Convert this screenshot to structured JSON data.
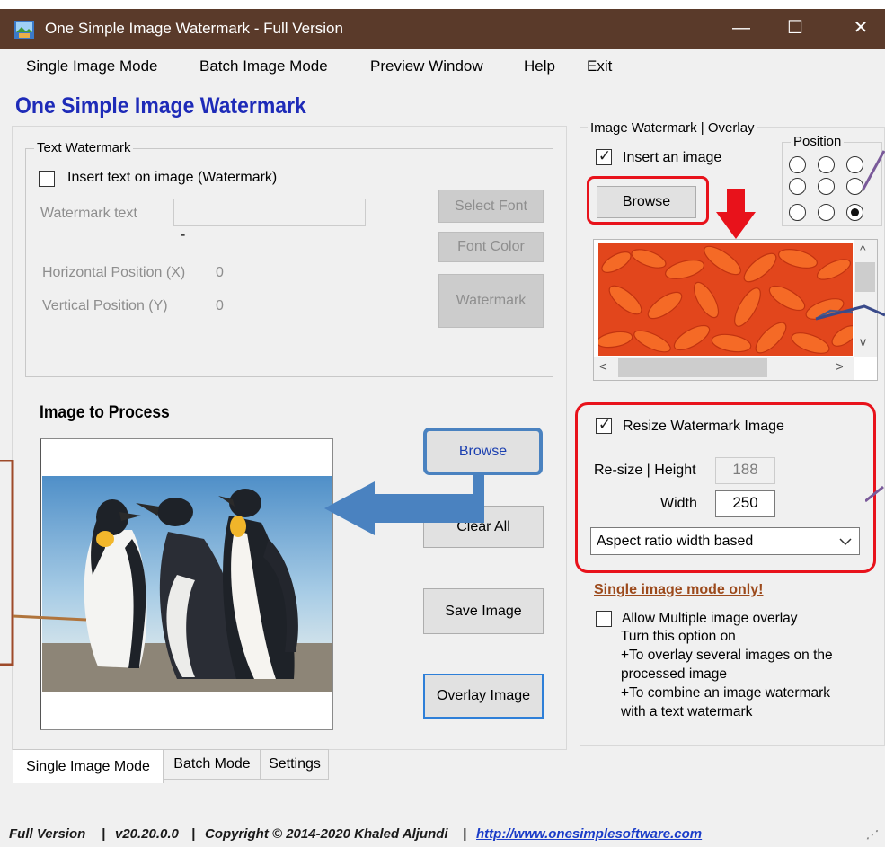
{
  "window": {
    "title": "One Simple Image Watermark - Full Version",
    "min_glyph": "—",
    "max_glyph": "☐",
    "close_glyph": "✕"
  },
  "menu": [
    "Single Image Mode",
    "Batch Image Mode",
    "Preview Window",
    "Help",
    "Exit"
  ],
  "heading": "One Simple Image Watermark",
  "text_watermark": {
    "legend": "Text Watermark",
    "insert_label": "Insert text on image (Watermark)",
    "insert_checked": false,
    "watermark_text_label": "Watermark text",
    "watermark_text_value": "",
    "dash": "-",
    "select_font_label": "Select Font",
    "font_color_label": "Font Color",
    "watermark_button_label": "Watermark",
    "hpos_label": "Horizontal Position (X)",
    "hpos_value": "0",
    "vpos_label": "Vertical Position (Y)",
    "vpos_value": "0"
  },
  "image_to_process": {
    "heading": "Image to Process",
    "browse_label": "Browse",
    "clear_all_label": "Clear All",
    "save_image_label": "Save Image",
    "overlay_image_label": "Overlay Image"
  },
  "image_overlay": {
    "legend": "Image Watermark | Overlay",
    "insert_label": "Insert an image",
    "insert_checked": true,
    "browse_label": "Browse",
    "position_legend": "Position",
    "position_selected": 8,
    "scroll_up": "^",
    "scroll_down": "v",
    "scroll_left": "<",
    "scroll_right": ">"
  },
  "resize": {
    "checkbox_label": "Resize Watermark Image",
    "checked": true,
    "height_label": "Re-size | Height",
    "height_value": "188",
    "width_label": "Width",
    "width_value": "250",
    "mode_value": "Aspect ratio width based"
  },
  "multi_overlay": {
    "note": "Single image mode only!",
    "checkbox_label": "Allow Multiple image overlay",
    "checked": false,
    "lines": [
      "Turn this option on",
      "+To overlay several images on the",
      "processed image",
      "+To combine an image watermark",
      "with a text watermark"
    ]
  },
  "tabs": [
    "Single Image Mode",
    "Batch Mode",
    "Settings"
  ],
  "status": {
    "edition": "Full Version",
    "sep1": "|",
    "version": "v20.20.0.0",
    "sep2": "|",
    "copyright": "Copyright © 2014-2020 Khaled Aljundi",
    "sep3": "|",
    "url": "http://www.onesimplesoftware.com"
  },
  "colors": {
    "title_bar": "#5a3a2a",
    "heading": "#1e2bb8",
    "annotation_red": "#e8121b",
    "annotation_blue": "#4a82c0",
    "note_brown": "#9c4a1c"
  }
}
